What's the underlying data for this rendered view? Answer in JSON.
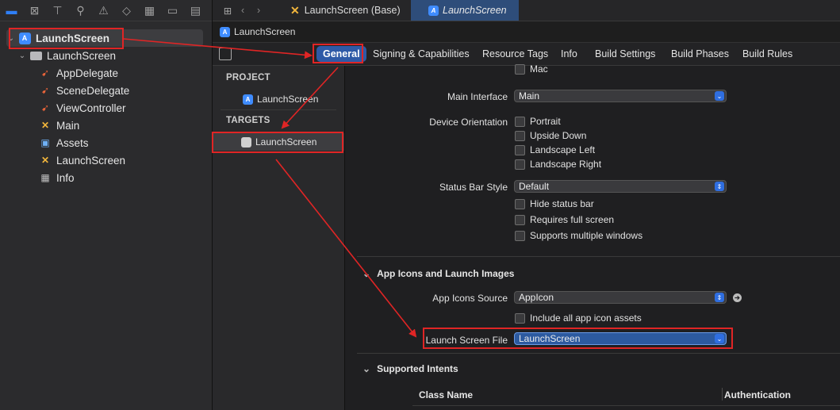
{
  "navigator": {
    "root": "LaunchScreen",
    "group": "LaunchScreen",
    "files": [
      {
        "name": "AppDelegate",
        "icon": "swift-file-icon"
      },
      {
        "name": "SceneDelegate",
        "icon": "swift-file-icon"
      },
      {
        "name": "ViewController",
        "icon": "swift-file-icon"
      },
      {
        "name": "Main",
        "icon": "storyboard-file-icon"
      },
      {
        "name": "Assets",
        "icon": "asset-catalog-icon"
      },
      {
        "name": "LaunchScreen",
        "icon": "storyboard-file-icon"
      },
      {
        "name": "Info",
        "icon": "plist-file-icon"
      }
    ]
  },
  "tabs": [
    "LaunchScreen (Base)",
    "LaunchScreen"
  ],
  "jumpbar": "LaunchScreen",
  "settings_tabs": [
    "General",
    "Signing & Capabilities",
    "Resource Tags",
    "Info",
    "Build Settings",
    "Build Phases",
    "Build Rules"
  ],
  "project_list": {
    "project_header": "PROJECT",
    "project_item": "LaunchScreen",
    "targets_header": "TARGETS",
    "target_item": "LaunchScreen"
  },
  "general": {
    "mac_label": "Mac",
    "main_interface_label": "Main Interface",
    "main_interface_value": "Main",
    "device_orientation_label": "Device Orientation",
    "orientations": [
      "Portrait",
      "Upside Down",
      "Landscape Left",
      "Landscape Right"
    ],
    "status_bar_style_label": "Status Bar Style",
    "status_bar_style_value": "Default",
    "status_bar_options": [
      "Hide status bar",
      "Requires full screen",
      "Supports multiple windows"
    ],
    "app_icons_section": "App Icons and Launch Images",
    "app_icons_source_label": "App Icons Source",
    "app_icons_source_value": "AppIcon",
    "include_all_assets": "Include all app icon assets",
    "launch_screen_file_label": "Launch Screen File",
    "launch_screen_file_value": "LaunchScreen",
    "supported_intents_section": "Supported Intents",
    "intents_columns": [
      "Class Name",
      "Authentication"
    ]
  },
  "colors": {
    "accent": "#2f6ee0",
    "annotation_red": "#e02525"
  }
}
